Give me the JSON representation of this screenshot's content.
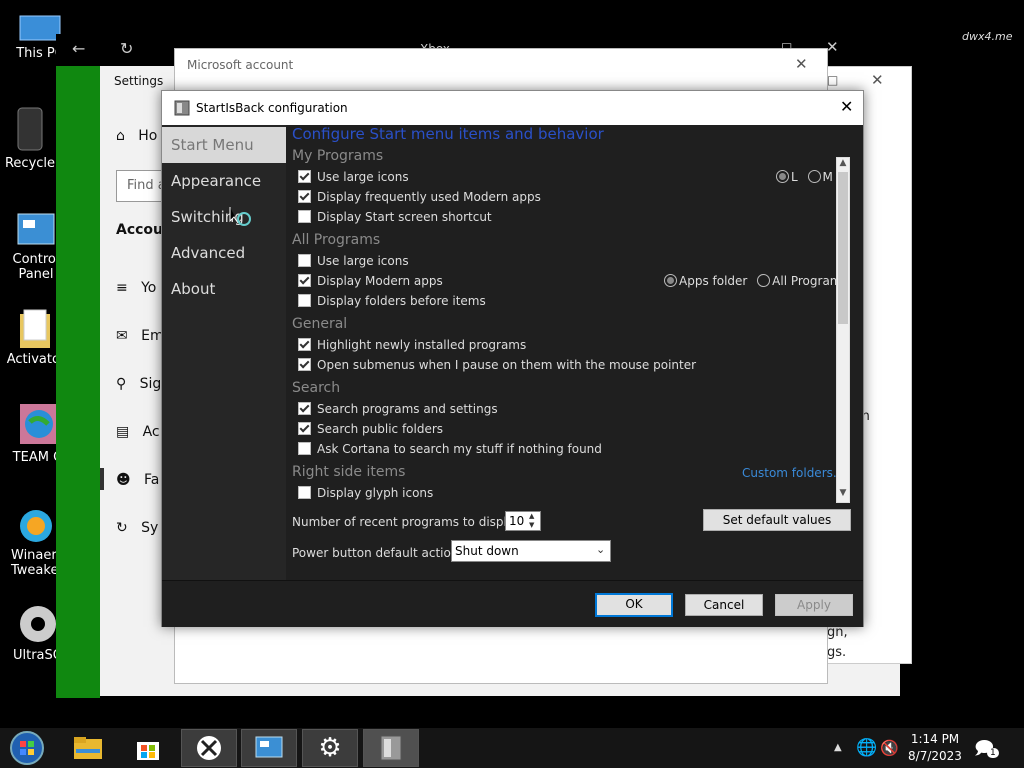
{
  "desktop": {
    "icons": [
      {
        "label": "This PC",
        "icon": "monitor-icon"
      },
      {
        "label": "Recycle",
        "icon": "recycle-bin-icon"
      },
      {
        "label": "Control Panel",
        "icon": "control-panel-icon"
      },
      {
        "label": "Activator",
        "icon": "folder-icon"
      },
      {
        "label": "TEAM O",
        "icon": "globe-icon"
      },
      {
        "label": "Winaero Tweaker",
        "icon": "winaero-icon"
      },
      {
        "label": "UltraSO",
        "icon": "disc-icon"
      }
    ],
    "watermark": "dwx4.me"
  },
  "xbox_window": {
    "title": "Xbox"
  },
  "settings_window": {
    "title": "Settings",
    "home_partial": "Ho",
    "search_partial": "Find a",
    "section_partial": "Accoun",
    "items_partial": [
      "Yo",
      "Em",
      "Sig",
      "Ac",
      "Fa",
      "Sy"
    ]
  },
  "ms_account": {
    "title": "Microsoft account"
  },
  "right_panel": {
    "lines": [
      "wn",
      "gn,",
      "gs."
    ]
  },
  "sib": {
    "title": "StartIsBack configuration",
    "nav": [
      "Start Menu",
      "Appearance",
      "Switching",
      "Advanced",
      "About"
    ],
    "heading": "Configure Start menu items and behavior",
    "my_programs": {
      "title": "My Programs",
      "options": [
        {
          "label": "Use large icons",
          "checked": true
        },
        {
          "label": "Display frequently used Modern apps",
          "checked": true
        },
        {
          "label": "Display Start screen shortcut",
          "checked": false
        }
      ],
      "size_radio": [
        {
          "label": "L",
          "selected": true
        },
        {
          "label": "M",
          "selected": false
        }
      ]
    },
    "all_programs": {
      "title": "All Programs",
      "options": [
        {
          "label": "Use large icons",
          "checked": false
        },
        {
          "label": "Display Modern apps",
          "checked": true
        },
        {
          "label": "Display folders before items",
          "checked": false
        }
      ],
      "apps_radio": [
        {
          "label": "Apps folder",
          "selected": true
        },
        {
          "label": "All Programs",
          "selected": false
        }
      ]
    },
    "general": {
      "title": "General",
      "options": [
        {
          "label": "Highlight newly installed programs",
          "checked": true
        },
        {
          "label": "Open submenus when I pause on them with the mouse pointer",
          "checked": true
        }
      ]
    },
    "search": {
      "title": "Search",
      "options": [
        {
          "label": "Search programs and settings",
          "checked": true
        },
        {
          "label": "Search public folders",
          "checked": true
        },
        {
          "label": "Ask Cortana to search my stuff if nothing found",
          "checked": false
        }
      ]
    },
    "right_side": {
      "title": "Right side items",
      "options": [
        {
          "label": "Display glyph icons",
          "checked": false
        }
      ],
      "custom_folders": "Custom folders..."
    },
    "recent_label": "Number of recent programs to display:",
    "recent_value": "10",
    "set_default": "Set default values",
    "power_label": "Power button default action:",
    "power_value": "Shut down",
    "ok": "OK",
    "cancel": "Cancel",
    "apply": "Apply"
  },
  "taskbar": {
    "time": "1:14 PM",
    "date": "8/7/2023",
    "notification_count": "1"
  },
  "colors": {
    "accent": "#0078d7",
    "heading": "#2a50c8",
    "link": "#3a8ad8",
    "xbox_green": "#108810"
  }
}
